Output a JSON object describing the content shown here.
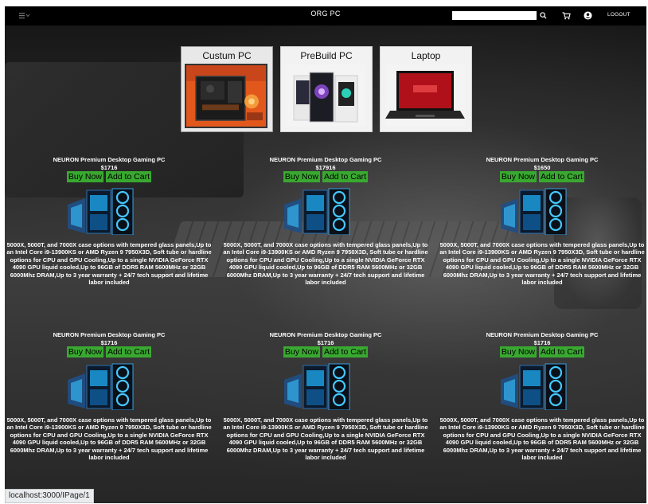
{
  "nav": {
    "brand": "ORG PC",
    "search_placeholder": "",
    "logout_label": "LOGOUT"
  },
  "categories": [
    {
      "label": "Custum PC",
      "active": true
    },
    {
      "label": "PreBuild PC",
      "active": false
    },
    {
      "label": "Laptop",
      "active": false
    }
  ],
  "products": [
    {
      "name": "NEURON Premium Desktop Gaming PC",
      "price": "$1716",
      "buy_label": "Buy Now",
      "cart_label": "Add to Cart",
      "description": "5000X, 5000T, and 7000X case options with tempered glass panels,Up to an Intel Core i9-13900KS or AMD Ryzen 9 7950X3D, Soft tube or hardline options for CPU and GPU Cooling,Up to a single NVIDIA GeForce RTX 4090 GPU liquid cooled,Up to 96GB of DDR5 RAM 5600MHz or 32GB 6000Mhz DRAM,Up to 3 year warranty + 24/7 tech support and lifetime labor included"
    },
    {
      "name": "NEURON Premium Desktop Gaming PC",
      "price": "$17916",
      "buy_label": "Buy Now",
      "cart_label": "Add to Cart",
      "description": "5000X, 5000T, and 7000X case options with tempered glass panels,Up to an Intel Core i9-13900KS or AMD Ryzen 9 7950X3D, Soft tube or hardline options for CPU and GPU Cooling,Up to a single NVIDIA GeForce RTX 4090 GPU liquid cooled,Up to 96GB of DDR5 RAM 5600MHz or 32GB 6000Mhz DRAM,Up to 3 year warranty + 24/7 tech support and lifetime labor included"
    },
    {
      "name": "NEURON Premium Desktop Gaming PC",
      "price": "$1650",
      "buy_label": "Buy Now",
      "cart_label": "Add to Cart",
      "description": "5000X, 5000T, and 7000X case options with tempered glass panels,Up to an Intel Core i9-13900KS or AMD Ryzen 9 7950X3D, Soft tube or hardline options for CPU and GPU Cooling,Up to a single NVIDIA GeForce RTX 4090 GPU liquid cooled,Up to 96GB of DDR5 RAM 5600MHz or 32GB 6000Mhz DRAM,Up to 3 year warranty + 24/7 tech support and lifetime labor included"
    },
    {
      "name": "NEURON Premium Desktop Gaming PC",
      "price": "$1716",
      "buy_label": "Buy Now",
      "cart_label": "Add to Cart",
      "description": "5000X, 5000T, and 7000X case options with tempered glass panels,Up to an Intel Core i9-13900KS or AMD Ryzen 9 7950X3D, Soft tube or hardline options for CPU and GPU Cooling,Up to a single NVIDIA GeForce RTX 4090 GPU liquid cooled,Up to 96GB of DDR5 RAM 5600MHz or 32GB 6000Mhz DRAM,Up to 3 year warranty + 24/7 tech support and lifetime labor included"
    },
    {
      "name": "NEURON Premium Desktop Gaming PC",
      "price": "$1716",
      "buy_label": "Buy Now",
      "cart_label": "Add to Cart",
      "description": "5000X, 5000T, and 7000X case options with tempered glass panels,Up to an Intel Core i9-13900KS or AMD Ryzen 9 7950X3D, Soft tube or hardline options for CPU and GPU Cooling,Up to a single NVIDIA GeForce RTX 4090 GPU liquid cooled,Up to 96GB of DDR5 RAM 5600MHz or 32GB 6000Mhz DRAM,Up to 3 year warranty + 24/7 tech support and lifetime labor included"
    },
    {
      "name": "NEURON Premium Desktop Gaming PC",
      "price": "$1716",
      "buy_label": "Buy Now",
      "cart_label": "Add to Cart",
      "description": "5000X, 5000T, and 7000X case options with tempered glass panels,Up to an Intel Core i9-13900KS or AMD Ryzen 9 7950X3D, Soft tube or hardline options for CPU and GPU Cooling,Up to a single NVIDIA GeForce RTX 4090 GPU liquid cooled,Up to 96GB of DDR5 RAM 5600MHz or 32GB 6000Mhz DRAM,Up to 3 year warranty + 24/7 tech support and lifetime labor included"
    }
  ],
  "status_bar": {
    "url": "localhost:3000/IPage/1"
  },
  "colors": {
    "button_green": "#39a830",
    "navbar": "#000000"
  },
  "icons": {
    "menu": "menu-icon",
    "search": "search-icon",
    "cart": "cart-icon",
    "account": "account-icon"
  }
}
